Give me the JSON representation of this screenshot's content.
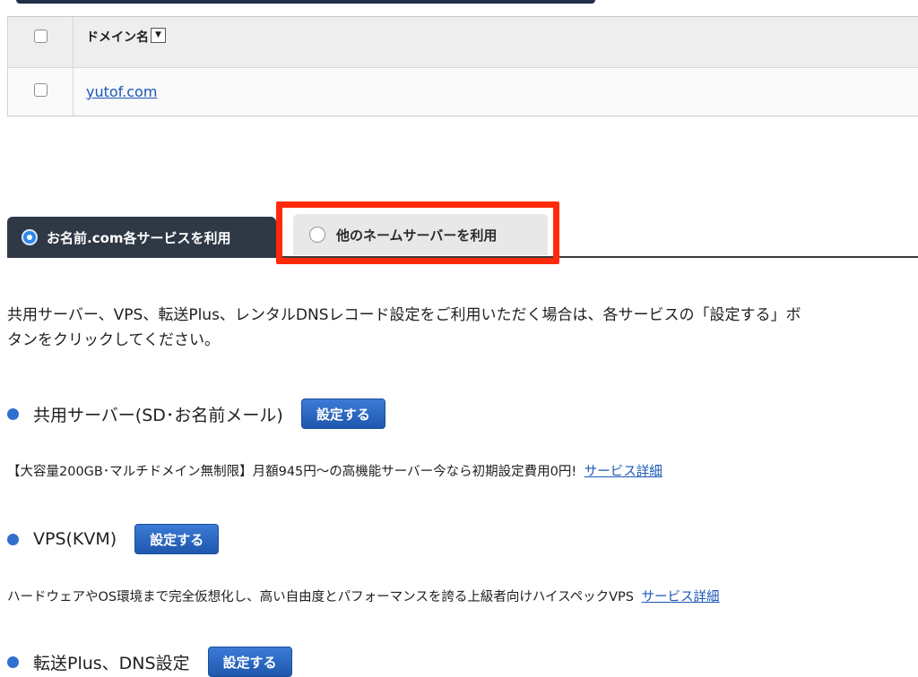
{
  "table": {
    "header_label": "ドメイン名",
    "sort_icon": "▼",
    "rows": [
      {
        "domain": "yutof.com"
      }
    ]
  },
  "tabs": {
    "active_label": "お名前.com各サービスを利用",
    "other_label": "他のネームサーバーを利用"
  },
  "intro_text": "共用サーバー、VPS、転送Plus、レンタルDNSレコード設定をご利用いただく場合は、各サービスの「設定する」ボタンをクリックしてください。",
  "intro_line1": "共用サーバー、VPS、転送Plus、レンタルDNSレコード設定をご利用いただく場合は、各サービスの「設定する」ボ",
  "intro_line2": "タンをクリックしてください。",
  "services": [
    {
      "title": "共用サーバー(SD･お名前メール)",
      "button": "設定する",
      "description": "【大容量200GB･マルチドメイン無制限】月額945円～の高機能サーバー今なら初期設定費用0円!",
      "link": "サービス詳細"
    },
    {
      "title": "VPS(KVM)",
      "button": "設定する",
      "description": "ハードウェアやOS環境まで完全仮想化し、高い自由度とパフォーマンスを誇る上級者向けハイスペックVPS",
      "link": "サービス詳細"
    },
    {
      "title": "転送Plus、DNS設定",
      "button": "設定する"
    }
  ],
  "colors": {
    "accent_blue": "#2f6fd0",
    "highlight_red": "#ff2a0a",
    "active_tab": "#2f3946"
  }
}
